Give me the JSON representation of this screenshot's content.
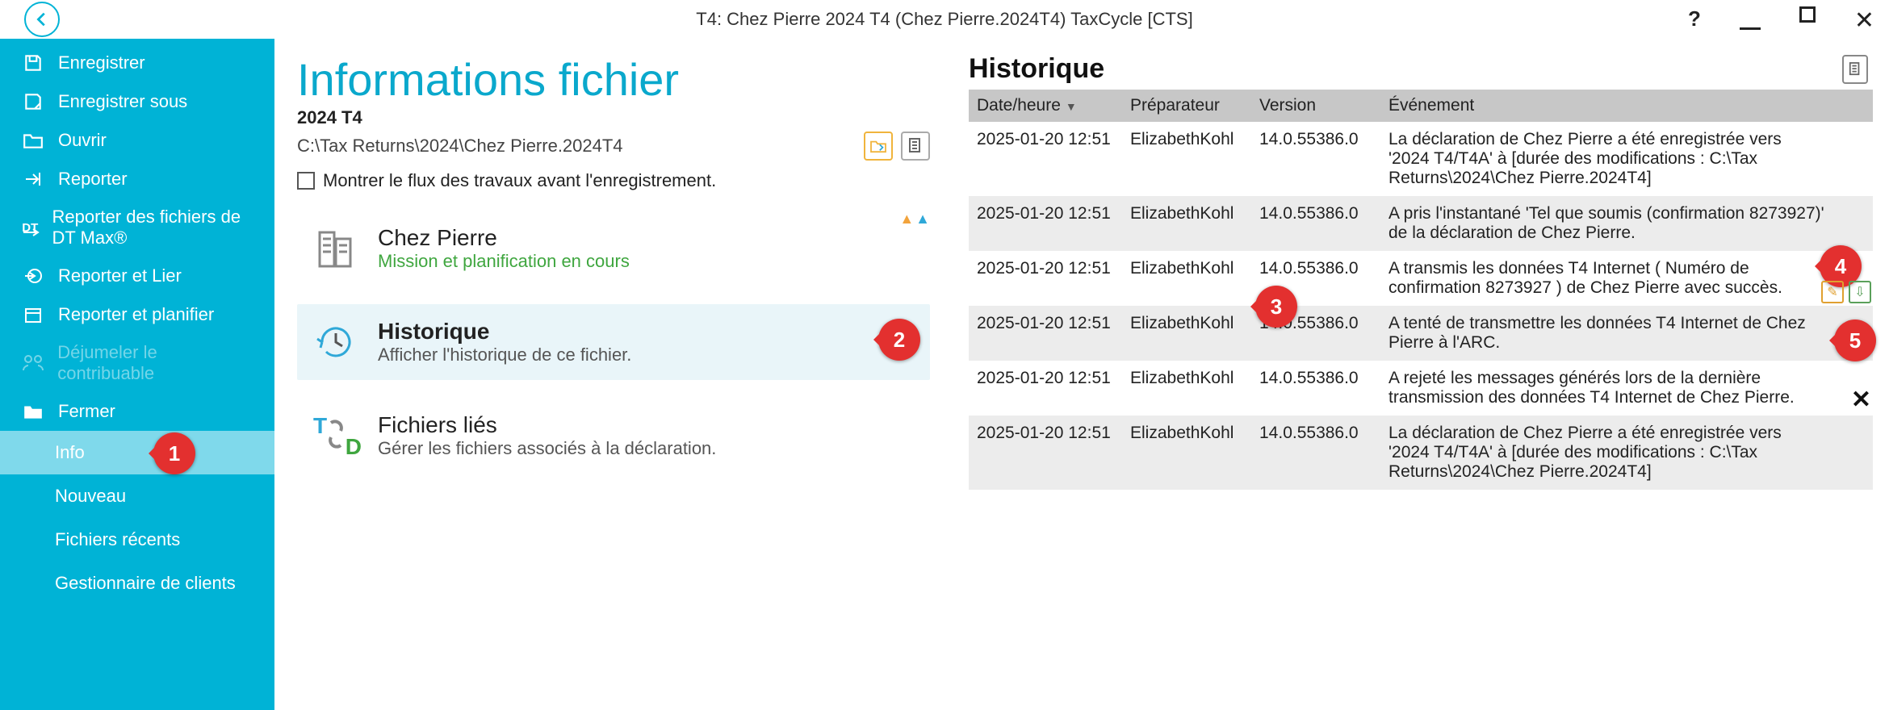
{
  "window": {
    "title": "T4: Chez Pierre 2024 T4 (Chez Pierre.2024T4) TaxCycle [CTS]"
  },
  "sidebar": {
    "items": [
      {
        "label": "Enregistrer"
      },
      {
        "label": "Enregistrer sous"
      },
      {
        "label": "Ouvrir"
      },
      {
        "label": "Reporter"
      },
      {
        "label": "Reporter des fichiers de DT Max®"
      },
      {
        "label": "Reporter et Lier"
      },
      {
        "label": "Reporter et planifier"
      },
      {
        "label": "Déjumeler le contribuable"
      },
      {
        "label": "Fermer"
      }
    ],
    "subs": [
      {
        "label": "Info"
      },
      {
        "label": "Nouveau"
      },
      {
        "label": "Fichiers récents"
      },
      {
        "label": "Gestionnaire de clients"
      }
    ]
  },
  "page": {
    "title": "Informations fichier",
    "year": "2024 T4",
    "path": "C:\\Tax Returns\\2024\\Chez Pierre.2024T4",
    "checkbox_label": "Montrer le flux des travaux avant l'enregistrement."
  },
  "cards": {
    "company": {
      "title": "Chez Pierre",
      "subtitle": "Mission et planification en cours"
    },
    "history": {
      "title": "Historique",
      "subtitle": "Afficher l'historique de ce fichier."
    },
    "linked": {
      "title": "Fichiers liés",
      "subtitle": "Gérer les fichiers associés à la déclaration."
    }
  },
  "history": {
    "heading": "Historique",
    "columns": {
      "dt": "Date/heure",
      "prep": "Préparateur",
      "ver": "Version",
      "evt": "Événement"
    },
    "rows": [
      {
        "dt": "2025-01-20 12:51",
        "prep": "ElizabethKohl",
        "ver": "14.0.55386.0",
        "evt": "La déclaration de Chez Pierre a été enregistrée vers '2024 T4/T4A' à [durée des modifications : C:\\Tax Returns\\2024\\Chez Pierre.2024T4]"
      },
      {
        "dt": "2025-01-20 12:51",
        "prep": "ElizabethKohl",
        "ver": "14.0.55386.0",
        "evt": "A pris l'instantané 'Tel que soumis (confirmation 8273927)' de la déclaration de Chez Pierre."
      },
      {
        "dt": "2025-01-20 12:51",
        "prep": "ElizabethKohl",
        "ver": "14.0.55386.0",
        "evt": "A transmis les données T4 Internet  ( Numéro de confirmation 8273927 ) de Chez Pierre avec succès."
      },
      {
        "dt": "2025-01-20 12:51",
        "prep": "ElizabethKohl",
        "ver": "14.0.55386.0",
        "evt": "A tenté de transmettre les données T4 Internet de Chez Pierre à l'ARC."
      },
      {
        "dt": "2025-01-20 12:51",
        "prep": "ElizabethKohl",
        "ver": "14.0.55386.0",
        "evt": "A rejeté les messages générés lors de la dernière transmission des données T4 Internet de Chez Pierre."
      },
      {
        "dt": "2025-01-20 12:51",
        "prep": "ElizabethKohl",
        "ver": "14.0.55386.0",
        "evt": "La déclaration de Chez Pierre a été enregistrée vers '2024 T4/T4A' à [durée des modifications : C:\\Tax Returns\\2024\\Chez Pierre.2024T4]"
      }
    ]
  },
  "callouts": {
    "c1": "1",
    "c2": "2",
    "c3": "3",
    "c4": "4",
    "c5": "5"
  }
}
